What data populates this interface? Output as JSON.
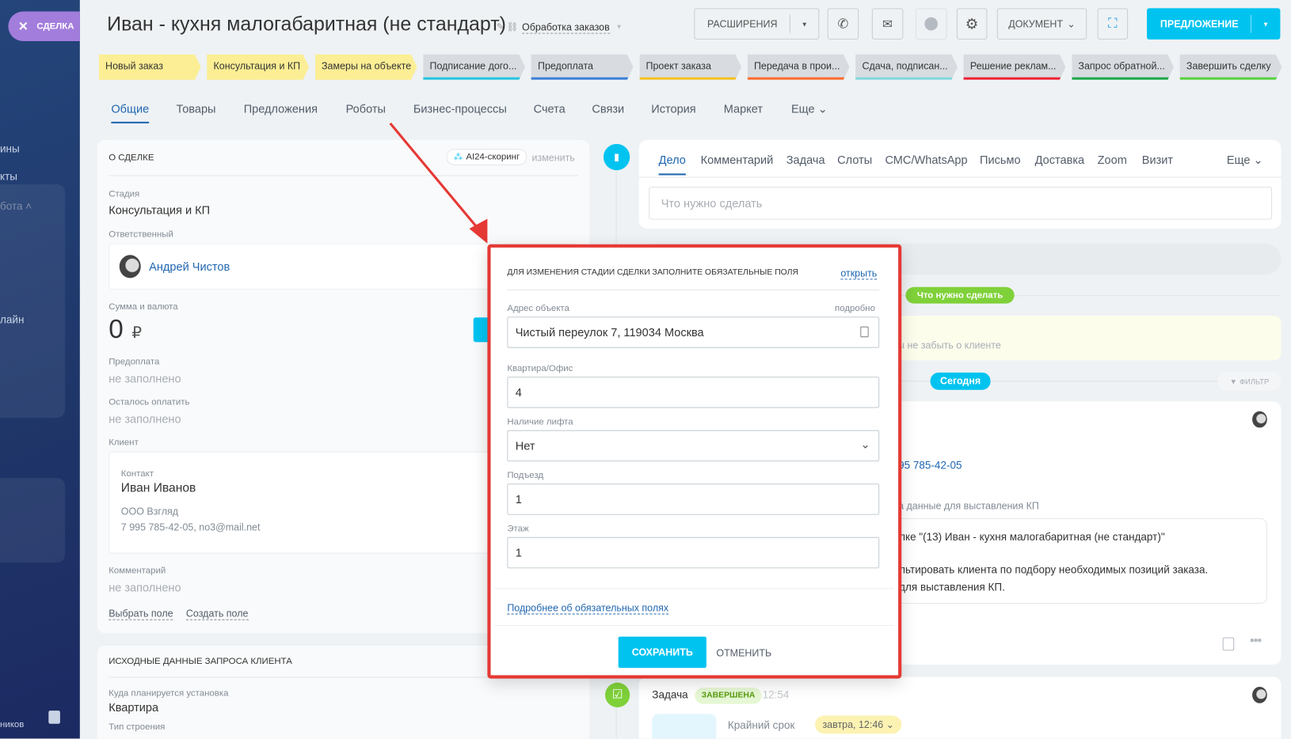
{
  "sidebar": {
    "deal_pill": "СДЕЛКА",
    "items": [
      "ины",
      "кты",
      "бота",
      "лайн",
      "ников"
    ]
  },
  "header": {
    "title": "Иван - кухня малогабаритная (не стандарт)",
    "category": "Обработка заказов",
    "extensions_label": "РАСШИРЕНИЯ",
    "document_label": "ДОКУМЕНТ",
    "offer_label": "ПРЕДЛОЖЕНИЕ"
  },
  "stages": [
    {
      "label": "Новый заказ",
      "color": "#fcee94",
      "bar": "#fcee94"
    },
    {
      "label": "Консультация и КП",
      "color": "#fcee94",
      "bar": "#fcee94"
    },
    {
      "label": "Замеры на объекте",
      "color": "#fcee94",
      "bar": "#fcee94"
    },
    {
      "label": "Подписание дого...",
      "color": "#d8dce1",
      "bar": "#22c5e0"
    },
    {
      "label": "Предоплата",
      "color": "#d8dce1",
      "bar": "#3a7fd6"
    },
    {
      "label": "Проект заказа",
      "color": "#d8dce1",
      "bar": "#f4c01f"
    },
    {
      "label": "Передача в прои...",
      "color": "#d8dce1",
      "bar": "#ff6a2b"
    },
    {
      "label": "Сдача, подписан...",
      "color": "#d8dce1",
      "bar": "#7fd8dd"
    },
    {
      "label": "Решение реклам...",
      "color": "#d8dce1",
      "bar": "#f01f32"
    },
    {
      "label": "Запрос обратной...",
      "color": "#d8dce1",
      "bar": "#1aa84b"
    },
    {
      "label": "Завершить сделку",
      "color": "#d8dce1",
      "bar": "#55d23e"
    }
  ],
  "tabs": [
    "Общие",
    "Товары",
    "Предложения",
    "Роботы",
    "Бизнес-процессы",
    "Счета",
    "Связи",
    "История",
    "Маркет",
    "Еще"
  ],
  "about": {
    "heading": "О СДЕЛКЕ",
    "scoring": "AI24-скоринг",
    "change": "изменить",
    "stage_label": "Стадия",
    "stage_value": "Консультация и КП",
    "responsible_label": "Ответственный",
    "responsible": "Андрей Чистов",
    "sum_label": "Сумма и валюта",
    "sum": "0",
    "currency": "₽",
    "prepay_label": "Предоплата",
    "prepay": "не заполнено",
    "remain_label": "Осталось оплатить",
    "remain": "не заполнено",
    "client_label": "Клиент",
    "contact_label": "Контакт",
    "contact": "Иван Иванов",
    "company": "ООО Взгляд",
    "contact_info": "7 995 785-42-05, no3@mail.net",
    "comment_label": "Комментарий",
    "comment": "не заполнено",
    "select_field": "Выбрать поле",
    "create_field": "Создать поле"
  },
  "request": {
    "heading": "ИСХОДНЫЕ ДАННЫЕ ЗАПРОСА КЛИЕНТА",
    "install_label": "Куда планируется установка",
    "install": "Квартира",
    "next_label": "Тип строения"
  },
  "activity": {
    "tabs": [
      "Дело",
      "Комментарий",
      "Задача",
      "Слоты",
      "СМС/WhatsApp",
      "Письмо",
      "Доставка",
      "Zoom",
      "Визит",
      "Еще"
    ],
    "placeholder": "Что нужно сделать",
    "todo_pill": "Что нужно сделать",
    "note": "ы не забыть о клиенте",
    "today": "Сегодня",
    "filter": "ФИЛЬТР",
    "phone": "95 785-42-05",
    "subtitle": "а данные для выставления КП",
    "line1": "лке \"(13) Иван - кухня малогабаритная (не стандарт)\"",
    "line2": "льтировать клиента по подбору необходимых позиций заказа.",
    "line3": "для выставления КП.",
    "task_label": "Задача",
    "task_status": "ЗАВЕРШЕНА",
    "task_time": "12:54",
    "deadline_label": "Крайний срок",
    "deadline": "завтра, 12:46"
  },
  "modal": {
    "title": "ДЛЯ ИЗМЕНЕНИЯ СТАДИИ СДЕЛКИ ЗАПОЛНИТЕ ОБЯЗАТЕЛЬНЫЕ ПОЛЯ",
    "open": "открыть",
    "address_label": "Адрес объекта",
    "details": "подробно",
    "address": "Чистый переулок 7, 119034 Москва",
    "apt_label": "Квартира/Офис",
    "apt": "4",
    "lift_label": "Наличие лифта",
    "lift": "Нет",
    "entrance_label": "Подъезд",
    "entrance": "1",
    "floor_label": "Этаж",
    "floor": "1",
    "more": "Подробнее об обязательных полях",
    "save": "СОХРАНИТЬ",
    "cancel": "ОТМЕНИТЬ"
  }
}
